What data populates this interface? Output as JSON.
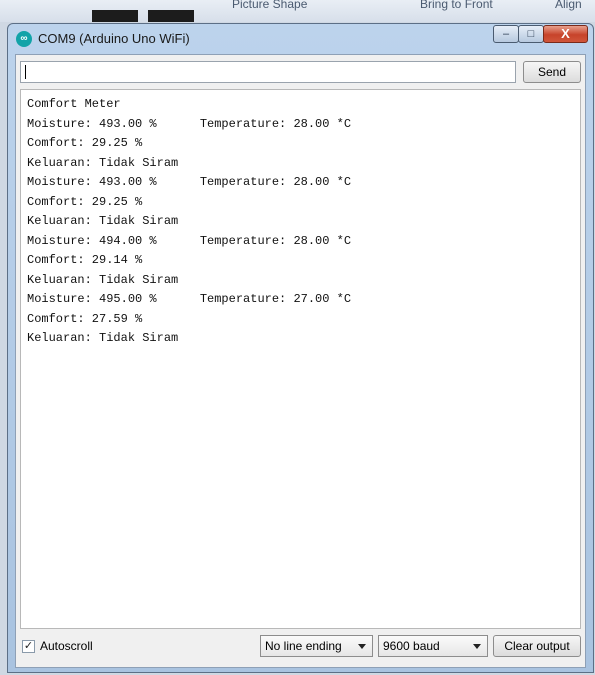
{
  "background_app": {
    "ribbon_items": [
      "Picture Shape",
      "Bring to Front",
      "Align"
    ]
  },
  "window": {
    "title": "COM9 (Arduino Uno WiFi)",
    "icon_glyph": "∞",
    "minimize_glyph": "–",
    "maximize_glyph": "□",
    "close_glyph": "X"
  },
  "input": {
    "value": "",
    "send_label": "Send"
  },
  "output": {
    "lines": [
      "Comfort Meter",
      "Moisture: 493.00 %      Temperature: 28.00 *C",
      "Comfort: 29.25 %",
      "Keluaran: Tidak Siram",
      "Moisture: 493.00 %      Temperature: 28.00 *C",
      "Comfort: 29.25 %",
      "Keluaran: Tidak Siram",
      "Moisture: 494.00 %      Temperature: 28.00 *C",
      "Comfort: 29.14 %",
      "Keluaran: Tidak Siram",
      "Moisture: 495.00 %      Temperature: 27.00 *C",
      "Comfort: 27.59 %",
      "Keluaran: Tidak Siram"
    ]
  },
  "footer": {
    "autoscroll_label": "Autoscroll",
    "autoscroll_checked": true,
    "check_glyph": "✓",
    "line_ending_selected": "No line ending",
    "baud_selected": "9600 baud",
    "clear_label": "Clear output"
  },
  "colors": {
    "accent_icon": "#12a3a8",
    "close_button": "#c7432a"
  }
}
